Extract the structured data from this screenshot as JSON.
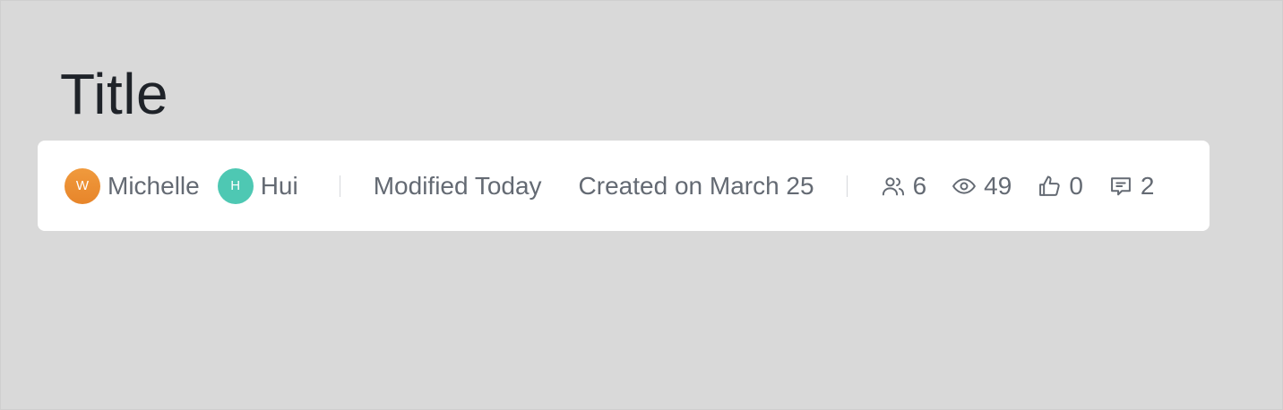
{
  "document": {
    "title": "Title"
  },
  "meta": {
    "authors": [
      {
        "initial": "W",
        "name": "Michelle",
        "avatar_color": "#ec8f35"
      },
      {
        "initial": "H",
        "name": "Hui",
        "avatar_color": "#4ec8b3"
      }
    ],
    "modified": "Modified Today",
    "created": "Created on March 25"
  },
  "stats": {
    "collaborators": {
      "icon": "users-icon",
      "count": "6"
    },
    "views": {
      "icon": "eye-icon",
      "count": "49"
    },
    "likes": {
      "icon": "thumbs-up-icon",
      "count": "0"
    },
    "comments": {
      "icon": "comment-icon",
      "count": "2"
    }
  }
}
